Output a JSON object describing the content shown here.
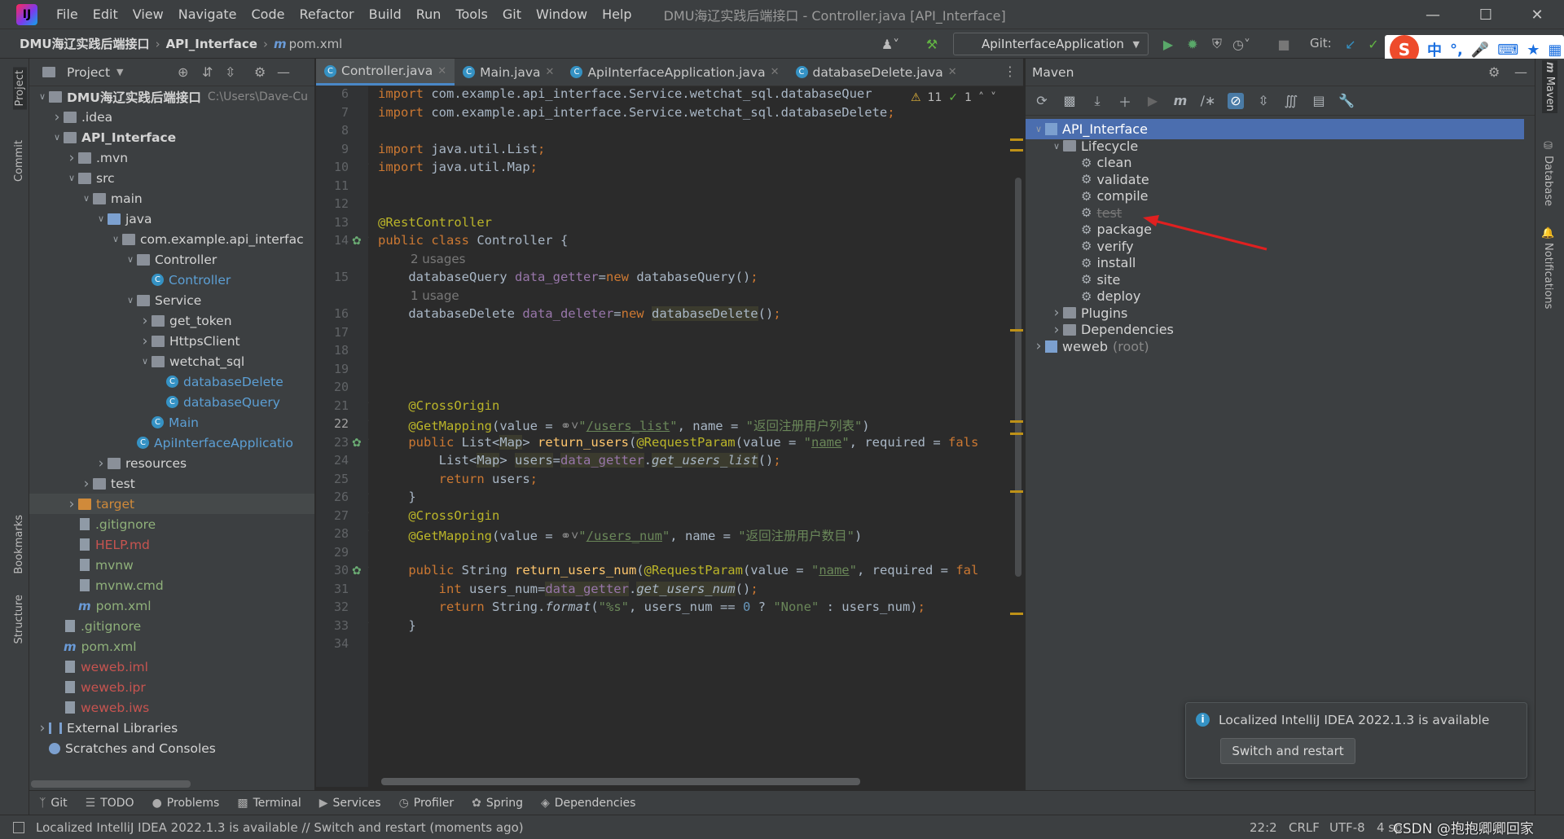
{
  "titlebar": {
    "menu": [
      "File",
      "Edit",
      "View",
      "Navigate",
      "Code",
      "Refactor",
      "Build",
      "Run",
      "Tools",
      "Git",
      "Window",
      "Help"
    ],
    "window_title": "DMU海辽实践后端接口 - Controller.java [API_Interface]"
  },
  "navbar": {
    "crumbs": [
      "DMU海辽实践后端接口",
      "API_Interface"
    ],
    "file": "pom.xml",
    "run_config": "ApiInterfaceApplication",
    "git_label": "Git:"
  },
  "ime": {
    "lang": "中"
  },
  "left_stripe": {
    "project": "Project",
    "commit": "Commit",
    "bookmarks": "Bookmarks",
    "structure": "Structure"
  },
  "project": {
    "title": "Project",
    "tree": [
      {
        "label": "DMU海辽实践后端接口",
        "extra": "C:\\Users\\Dave-Cu",
        "arrow": "down",
        "indent": 0,
        "icon": "folder",
        "bold": true
      },
      {
        "label": ".idea",
        "arrow": "right",
        "indent": 1,
        "icon": "folder"
      },
      {
        "label": "API_Interface",
        "arrow": "down",
        "indent": 1,
        "icon": "folder",
        "bold": true
      },
      {
        "label": ".mvn",
        "arrow": "right",
        "indent": 2,
        "icon": "folder"
      },
      {
        "label": "src",
        "arrow": "down",
        "indent": 2,
        "icon": "folder"
      },
      {
        "label": "main",
        "arrow": "down",
        "indent": 3,
        "icon": "folder"
      },
      {
        "label": "java",
        "arrow": "down",
        "indent": 4,
        "icon": "folder-blue"
      },
      {
        "label": "com.example.api_interfac",
        "arrow": "down",
        "indent": 5,
        "icon": "folder"
      },
      {
        "label": "Controller",
        "arrow": "down",
        "indent": 6,
        "icon": "folder"
      },
      {
        "label": "Controller",
        "arrow": "",
        "indent": 7,
        "icon": "class",
        "color": "#5c9fd4"
      },
      {
        "label": "Service",
        "arrow": "down",
        "indent": 6,
        "icon": "folder"
      },
      {
        "label": "get_token",
        "arrow": "right",
        "indent": 7,
        "icon": "folder"
      },
      {
        "label": "HttpsClient",
        "arrow": "right",
        "indent": 7,
        "icon": "folder"
      },
      {
        "label": "wetchat_sql",
        "arrow": "down",
        "indent": 7,
        "icon": "folder"
      },
      {
        "label": "databaseDelete",
        "arrow": "",
        "indent": 8,
        "icon": "class",
        "color": "#5c9fd4"
      },
      {
        "label": "databaseQuery",
        "arrow": "",
        "indent": 8,
        "icon": "class",
        "color": "#5c9fd4"
      },
      {
        "label": "Main",
        "arrow": "",
        "indent": 7,
        "icon": "class",
        "color": "#5c9fd4"
      },
      {
        "label": "ApiInterfaceApplicatio",
        "arrow": "",
        "indent": 6,
        "icon": "class",
        "color": "#5c9fd4"
      },
      {
        "label": "resources",
        "arrow": "right",
        "indent": 4,
        "icon": "folder"
      },
      {
        "label": "test",
        "arrow": "right",
        "indent": 3,
        "icon": "folder"
      },
      {
        "label": "target",
        "arrow": "right",
        "indent": 2,
        "icon": "folder-orange",
        "color": "#d08a3a",
        "highlight": true
      },
      {
        "label": ".gitignore",
        "arrow": "",
        "indent": 2,
        "icon": "file",
        "color": "#8fb07a"
      },
      {
        "label": "HELP.md",
        "arrow": "",
        "indent": 2,
        "icon": "file",
        "color": "#c75450"
      },
      {
        "label": "mvnw",
        "arrow": "",
        "indent": 2,
        "icon": "file",
        "color": "#8fb07a"
      },
      {
        "label": "mvnw.cmd",
        "arrow": "",
        "indent": 2,
        "icon": "file",
        "color": "#8fb07a"
      },
      {
        "label": "pom.xml",
        "arrow": "",
        "indent": 2,
        "icon": "maven",
        "color": "#8fb07a"
      },
      {
        "label": ".gitignore",
        "arrow": "",
        "indent": 1,
        "icon": "file",
        "color": "#8fb07a"
      },
      {
        "label": "pom.xml",
        "arrow": "",
        "indent": 1,
        "icon": "maven",
        "color": "#8fb07a"
      },
      {
        "label": "weweb.iml",
        "arrow": "",
        "indent": 1,
        "icon": "file",
        "color": "#c75450"
      },
      {
        "label": "weweb.ipr",
        "arrow": "",
        "indent": 1,
        "icon": "file",
        "color": "#c75450"
      },
      {
        "label": "weweb.iws",
        "arrow": "",
        "indent": 1,
        "icon": "file",
        "color": "#c75450"
      },
      {
        "label": "External Libraries",
        "arrow": "right",
        "indent": 0,
        "icon": "lib"
      },
      {
        "label": "Scratches and Consoles",
        "arrow": "",
        "indent": 0,
        "icon": "scratch"
      }
    ]
  },
  "tabs": [
    {
      "label": "Controller.java",
      "active": true
    },
    {
      "label": "Main.java",
      "active": false
    },
    {
      "label": "ApiInterfaceApplication.java",
      "active": false
    },
    {
      "label": "databaseDelete.java",
      "active": false
    }
  ],
  "editor": {
    "inspection": {
      "warnings": "11",
      "ok": "1"
    },
    "lines": [
      {
        "n": "6",
        "html": "<span style='color:#cc7832'>import</span> com.example.api_interface.Service.wetchat_sql.databaseQuer"
      },
      {
        "n": "7",
        "html": "<span style='color:#cc7832'>import</span> com.example.api_interface.Service.wetchat_sql.databaseDelete<span style='color:#cc7832'>;</span>"
      },
      {
        "n": "8",
        "html": ""
      },
      {
        "n": "9",
        "html": "<span style='color:#cc7832'>import</span> java.util.List<span style='color:#cc7832'>;</span>"
      },
      {
        "n": "10",
        "html": "<span style='color:#cc7832'>import</span> java.util.Map<span style='color:#cc7832'>;</span>"
      },
      {
        "n": "11",
        "html": ""
      },
      {
        "n": "12",
        "html": ""
      },
      {
        "n": "13",
        "html": "<span style='color:#bbb529'>@RestController</span>"
      },
      {
        "n": "14",
        "html": "<span style='color:#cc7832'>public class</span> Controller {"
      },
      {
        "n": "",
        "hint": "2 usages"
      },
      {
        "n": "15",
        "html": "    databaseQuery <span style='color:#9876aa'>data_getter</span>=<span style='color:#cc7832'>new</span> databaseQuery()<span style='color:#cc7832'>;</span>"
      },
      {
        "n": "",
        "hint": "1 usage"
      },
      {
        "n": "16",
        "html": "    databaseDelete <span style='color:#9876aa'>data_deleter</span>=<span style='color:#cc7832'>new</span> <span style='background:#3b3b2e'>databaseDelete</span>()<span style='color:#cc7832'>;</span>"
      },
      {
        "n": "17",
        "html": ""
      },
      {
        "n": "18",
        "html": ""
      },
      {
        "n": "19",
        "html": ""
      },
      {
        "n": "20",
        "html": ""
      },
      {
        "n": "21",
        "html": "    <span style='color:#bbb529'>@CrossOrigin</span>"
      },
      {
        "n": "22",
        "html": "    <span style='color:#bbb529'>@GetMapping</span>(value = <span style='color:#8a8a8a'>&#9901;&#709;</span><span style='color:#6a8759'>\"<u>/users_list</u>\"</span>, name = <span style='color:#6a8759'>\"返回注册用户列表\"</span>)"
      },
      {
        "n": "23",
        "html": "    <span style='color:#cc7832'>public</span> List&lt;<span style='background:#3b3b2e'>Map</span>&gt; <span style='color:#ffc66d'>return_users</span>(<span style='color:#bbb529'>@RequestParam</span>(value = <span style='color:#6a8759'>\"<u>name</u>\"</span>, required = <span style='color:#cc7832'>fals</span>"
      },
      {
        "n": "24",
        "html": "        List&lt;<span style='background:#3b3b2e'>Map</span>&gt; <span style='background:#3b3b2e'>users</span>=<span style='color:#9876aa;background:#3b3b2e'>data_getter</span>.<span style='font-style:italic;background:#3b3b2e'>get_users_list</span>()<span style='color:#cc7832'>;</span>"
      },
      {
        "n": "25",
        "html": "        <span style='color:#cc7832'>return</span> users<span style='color:#cc7832'>;</span>"
      },
      {
        "n": "26",
        "html": "    }"
      },
      {
        "n": "27",
        "html": "    <span style='color:#bbb529'>@CrossOrigin</span>"
      },
      {
        "n": "28",
        "html": "    <span style='color:#bbb529'>@GetMapping</span>(value = <span style='color:#8a8a8a'>&#9901;&#709;</span><span style='color:#6a8759'>\"<u>/users_num</u>\"</span>, name = <span style='color:#6a8759'>\"返回注册用户数目\"</span>)"
      },
      {
        "n": "29",
        "html": ""
      },
      {
        "n": "30",
        "html": "    <span style='color:#cc7832'>public</span> String <span style='color:#ffc66d'>return_users_num</span>(<span style='color:#bbb529'>@RequestParam</span>(value = <span style='color:#6a8759'>\"<u>name</u>\"</span>, required = <span style='color:#cc7832'>fal</span>"
      },
      {
        "n": "31",
        "html": "        <span style='color:#cc7832'>int</span> users_num=<span style='color:#9876aa;background:#3b3b2e'>data_getter</span>.<span style='font-style:italic;background:#3b3b2e'>get_users_num</span>()<span style='color:#cc7832'>;</span>"
      },
      {
        "n": "32",
        "html": "        <span style='color:#cc7832'>return</span> String.<span style='font-style:italic'>format</span>(<span style='color:#6a8759'>\"%s\"</span>, users_num == <span style='color:#6897bb'>0</span> ? <span style='color:#6a8759'>\"None\"</span> : users_num)<span style='color:#cc7832'>;</span>"
      },
      {
        "n": "33",
        "html": "    }"
      },
      {
        "n": "34",
        "html": ""
      }
    ]
  },
  "maven": {
    "title": "Maven",
    "tree": [
      {
        "label": "API_Interface",
        "arrow": "down",
        "indent": 0,
        "kind": "module",
        "selected": true
      },
      {
        "label": "Lifecycle",
        "arrow": "down",
        "indent": 1,
        "kind": "folder"
      },
      {
        "label": "clean",
        "indent": 2,
        "kind": "goal"
      },
      {
        "label": "validate",
        "indent": 2,
        "kind": "goal"
      },
      {
        "label": "compile",
        "indent": 2,
        "kind": "goal"
      },
      {
        "label": "test",
        "indent": 2,
        "kind": "goal",
        "disabled": true
      },
      {
        "label": "package",
        "indent": 2,
        "kind": "goal"
      },
      {
        "label": "verify",
        "indent": 2,
        "kind": "goal"
      },
      {
        "label": "install",
        "indent": 2,
        "kind": "goal"
      },
      {
        "label": "site",
        "indent": 2,
        "kind": "goal"
      },
      {
        "label": "deploy",
        "indent": 2,
        "kind": "goal"
      },
      {
        "label": "Plugins",
        "arrow": "right",
        "indent": 1,
        "kind": "folder"
      },
      {
        "label": "Dependencies",
        "arrow": "right",
        "indent": 1,
        "kind": "folder"
      },
      {
        "label": "weweb",
        "extra": "(root)",
        "arrow": "right",
        "indent": 0,
        "kind": "module"
      }
    ]
  },
  "right_stripe": {
    "maven": "Maven",
    "database": "Database",
    "notifications": "Notifications"
  },
  "notification": {
    "text": "Localized IntelliJ IDEA 2022.1.3 is available",
    "button": "Switch and restart"
  },
  "tools": [
    "Git",
    "TODO",
    "Problems",
    "Terminal",
    "Services",
    "Profiler",
    "Spring",
    "Dependencies"
  ],
  "status": {
    "message": "Localized IntelliJ IDEA 2022.1.3 is available // Switch and restart (moments ago)",
    "position": "22:2",
    "line_sep": "CRLF",
    "encoding": "UTF-8",
    "indent": "4 sp",
    "watermark": "CSDN @抱抱卿卿回家"
  }
}
